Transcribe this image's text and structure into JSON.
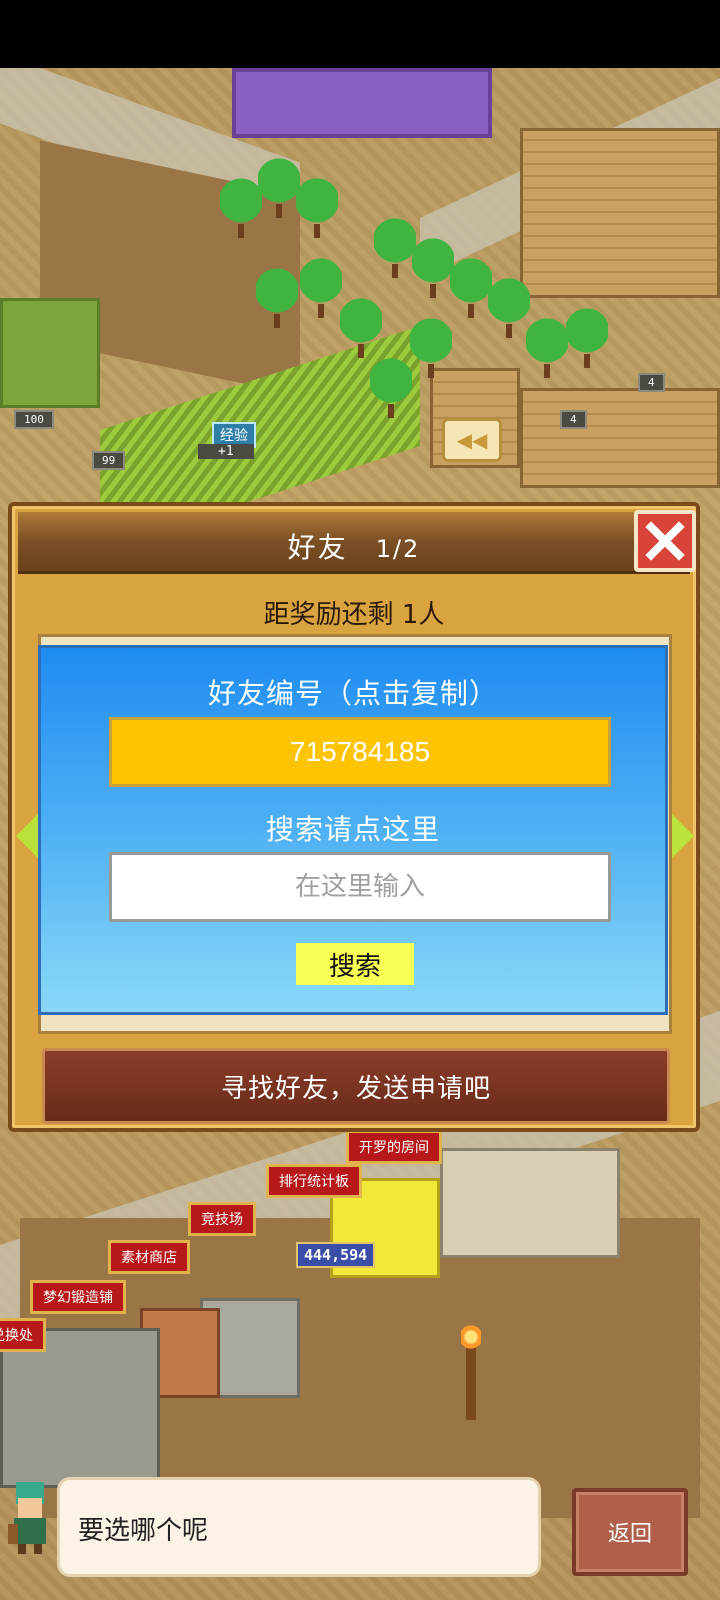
{
  "friends_panel": {
    "title": "好友",
    "page": "1/2",
    "reward_text": "距奖励还剩 1人",
    "find_button": "寻找好友，发送申请吧"
  },
  "popup": {
    "title": "好友编号（点击复制）",
    "friend_id": "715784185",
    "search_hint": "搜索请点这里",
    "input_placeholder": "在这里输入",
    "search_button": "搜索"
  },
  "town_labels": {
    "kairo_room": "开罗的房间",
    "ranking": "排行统计板",
    "arena": "竞技场",
    "material_shop": "素材商店",
    "dream_forge": "梦幻锻造铺",
    "exchange": "兑换处",
    "coin_counter": "444,594"
  },
  "counters": [
    "100",
    "99",
    "4",
    "4"
  ],
  "exp_label": "经验",
  "exp_gain": "+1",
  "dialog": {
    "text": "要选哪个呢"
  },
  "back_button": "返回",
  "colors": {
    "panel": "#d9a340",
    "popup_top": "#1f8cf2",
    "id_box": "#ffc400",
    "search_button": "#f8ff55",
    "close_button": "#d9443a"
  }
}
